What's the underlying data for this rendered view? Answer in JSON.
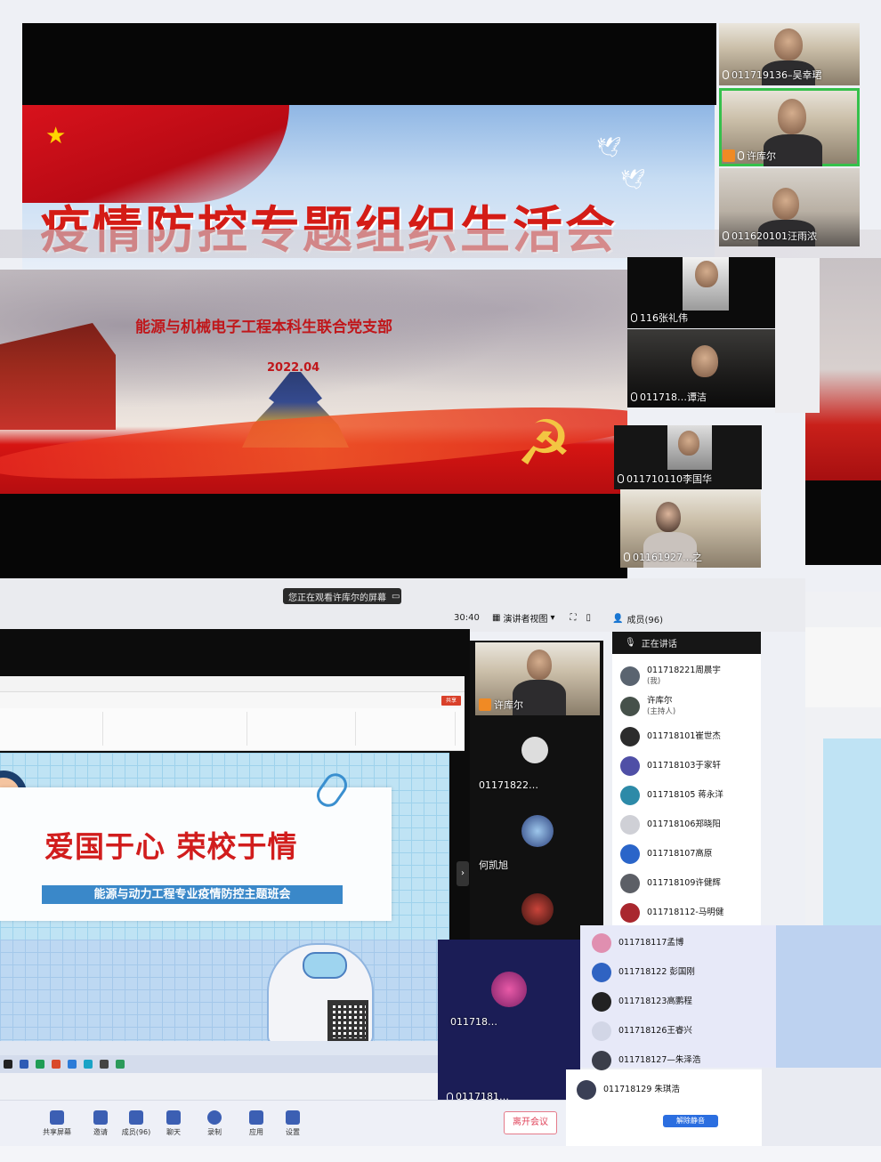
{
  "slides": {
    "top_title": "疫情防控专题组织生活会",
    "org_name": "能源与机械电子工程本科生联合党支部",
    "date": "2022.04"
  },
  "video_tiles": [
    {
      "name": "011719136–吴幸珺"
    },
    {
      "name": "许库尔"
    },
    {
      "name": "011620101汪雨浓"
    },
    {
      "name": "116张礼伟"
    },
    {
      "name": "011718…谭洁"
    },
    {
      "name": "011710110李国华"
    },
    {
      "name": "01161927…之"
    }
  ],
  "meeting_bar": {
    "viewing_notice": "您正在观看许库尔的屏幕",
    "timer": "30:40",
    "view_mode": "演讲者视图",
    "members_count": "成员(96)"
  },
  "shared_screen": {
    "ppt_title": "爱国于心  荣校于情",
    "ppt_subtitle": "能源与动力工程专业疫情防控主题班会",
    "share_label": "共享"
  },
  "mid_tiles": [
    {
      "name": "许库尔"
    },
    {
      "name": "01171822…"
    },
    {
      "name": "何凯旭"
    },
    {
      "name": "011718…"
    },
    {
      "name": "0117181…"
    }
  ],
  "members": {
    "speaking_header": "正在讲话",
    "list": [
      {
        "name": "011718221周晨宇",
        "role": "(我)",
        "color": "#5a6470"
      },
      {
        "name": "许库尔",
        "role": "(主持人)",
        "color": "#46514a"
      },
      {
        "name": "011718101崔世杰",
        "role": "",
        "color": "#2c2c2c"
      },
      {
        "name": "011718103于家轩",
        "role": "",
        "color": "#4f4fa6"
      },
      {
        "name": "011718105 蒋永洋",
        "role": "",
        "color": "#2d8aa8"
      },
      {
        "name": "011718106郑晓阳",
        "role": "",
        "color": "#cfd0d6"
      },
      {
        "name": "011718107高原",
        "role": "",
        "color": "#2a65c9"
      },
      {
        "name": "011718109许健辉",
        "role": "",
        "color": "#5c5f66"
      },
      {
        "name": "011718112-马明健",
        "role": "",
        "color": "#a9272e"
      },
      {
        "name": "011718117孟博",
        "role": "",
        "color": "#e08fb0"
      },
      {
        "name": "011718122 彭国刚",
        "role": "",
        "color": "#2f63c2"
      },
      {
        "name": "011718123高鹏程",
        "role": "",
        "color": "#222"
      },
      {
        "name": "011718126王睿兴",
        "role": "",
        "color": "#d2d6e6"
      },
      {
        "name": "011718127—朱泽浩",
        "role": "",
        "color": "#3b3e4a"
      },
      {
        "name": "011718129 朱琪浩",
        "role": "",
        "color": "#3a3f55"
      }
    ],
    "unmute_all": "解除静音"
  },
  "toolbar": {
    "items": [
      "共享屏幕",
      "邀请",
      "成员(96)",
      "聊天",
      "录制",
      "应用",
      "设置"
    ],
    "leave": "离开会议"
  },
  "colors": {
    "accent_blue": "#2b6ee0",
    "leave_red": "#e0435a",
    "active_speaker_green": "#35c04b",
    "title_red": "#d41c16"
  }
}
